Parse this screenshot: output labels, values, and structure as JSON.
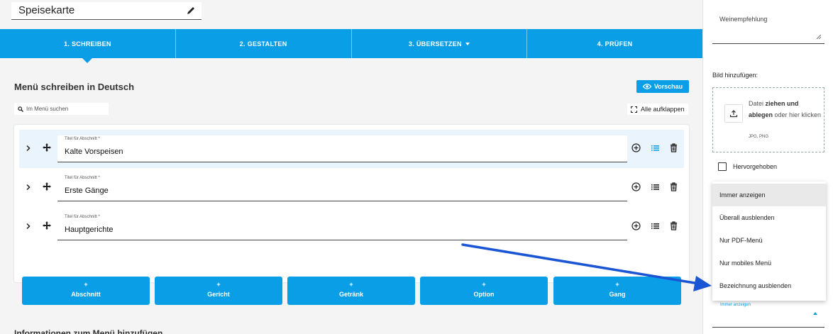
{
  "menu_name": "Speisekarte",
  "tabs": [
    {
      "label": "1. SCHREIBEN",
      "active": true
    },
    {
      "label": "2. GESTALTEN",
      "active": false
    },
    {
      "label": "3. ÜBERSETZEN",
      "active": false,
      "has_dropdown": true
    },
    {
      "label": "4. PRÜFEN",
      "active": false
    }
  ],
  "editor": {
    "heading": "Menü schreiben in Deutsch",
    "preview_label": "Vorschau",
    "search_placeholder": "Im Menü suchen",
    "expand_all_label": "Alle aufklappen",
    "sections": [
      {
        "field_label": "Titel für Abschnitt *",
        "title": "Kalte Vorspeisen",
        "highlighted": true
      },
      {
        "field_label": "Titel für Abschnitt *",
        "title": "Erste Gänge",
        "highlighted": false
      },
      {
        "field_label": "Titel für Abschnitt *",
        "title": "Hauptgerichte",
        "highlighted": false
      }
    ],
    "add_buttons": [
      {
        "plus": "+",
        "label": "Abschnitt"
      },
      {
        "plus": "+",
        "label": "Gericht"
      },
      {
        "plus": "+",
        "label": "Getränk"
      },
      {
        "plus": "+",
        "label": "Option"
      },
      {
        "plus": "+",
        "label": "Gang"
      }
    ],
    "info_heading": "Informationen zum Menü hinzufügen"
  },
  "side_panel": {
    "wine_label": "Weinempfehlung",
    "image_label": "Bild hinzufügen:",
    "dropzone": {
      "text_prefix": "Datei ",
      "text_bold": "ziehen und ablegen",
      "text_suffix": " oder hier klicken",
      "formats": "JPG, PNG"
    },
    "highlight_label": "Hervorgehoben",
    "highlight_checked": false,
    "visibility_options": [
      {
        "label": "Immer anzeigen",
        "selected": true
      },
      {
        "label": "Überall ausblenden",
        "selected": false
      },
      {
        "label": "Nur PDF-Menü",
        "selected": false
      },
      {
        "label": "Nur mobiles Menü",
        "selected": false
      },
      {
        "label": "Bezeichnung ausblenden",
        "selected": false
      }
    ],
    "visibility_field_label": "Immer anzeigen"
  },
  "colors": {
    "accent": "#0a9ee6",
    "arrow": "#1a55d4",
    "highlight_row": "#e9f4fc"
  }
}
